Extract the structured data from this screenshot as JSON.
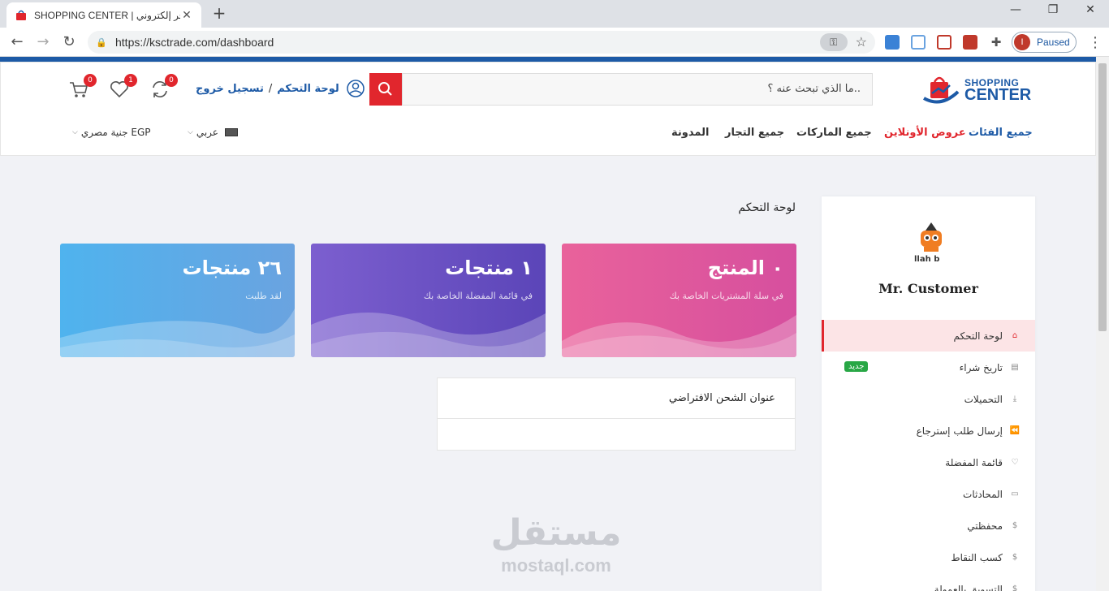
{
  "browser": {
    "tab_title": "SHOPPING CENTER | متجر إلكتروني",
    "url": "https://ksctrade.com/dashboard",
    "profile_label": "Paused",
    "profile_initial": "I"
  },
  "header": {
    "logo_line1": "SHOPPING",
    "logo_line2": "CENTER",
    "search_placeholder": "ما الذي تبحث عنه ؟..",
    "user_links": {
      "dashboard": "لوحة التحكم",
      "separator": "/",
      "logout": "تسجيل خروج"
    },
    "badges": {
      "compare": "0",
      "wishlist": "1",
      "cart": "0"
    },
    "nav": [
      "جميع الفئات",
      "عروض الأونلاين",
      "جميع الماركات",
      "جميع التجار",
      "المدونة"
    ],
    "language": "عربي",
    "currency": "جنية مصري EGP"
  },
  "sidebar": {
    "customer_name": "Mr. Customer",
    "menu": [
      {
        "label": "لوحة التحكم",
        "icon": "home-icon",
        "active": true
      },
      {
        "label": "تاريخ شراء",
        "icon": "file-icon",
        "badge": "جديد"
      },
      {
        "label": "التحميلات",
        "icon": "download-icon"
      },
      {
        "label": "إرسال طلب إسترجاع",
        "icon": "rewind-icon"
      },
      {
        "label": "قائمة المفضلة",
        "icon": "heart-icon"
      },
      {
        "label": "المحادثات",
        "icon": "chat-icon"
      },
      {
        "label": "محفظتي",
        "icon": "dollar-icon"
      },
      {
        "label": "كسب النقاط",
        "icon": "dollar-icon"
      },
      {
        "label": "التسويق بالعمولة",
        "icon": "dollar-icon"
      }
    ]
  },
  "main": {
    "heading": "لوحة التحكم",
    "cards": [
      {
        "title": "٠ المنتج",
        "subtitle": "في سلة المشتريات الخاصة بك",
        "color_from": "#d64f9e",
        "color_to": "#e9629b"
      },
      {
        "title": "١ منتجات",
        "subtitle": "في قائمة المفضلة الخاصة بك",
        "color_from": "#5b45b8",
        "color_to": "#7c5fcf"
      },
      {
        "title": "٢٦ منتجات",
        "subtitle": "لقد طلبت",
        "color_from": "#6aa3e0",
        "color_to": "#4fb3ee"
      }
    ],
    "address_title": "عنوان الشحن الافتراضي"
  },
  "watermark": {
    "arabic": "مستقل",
    "latin": "mostaql.com"
  }
}
